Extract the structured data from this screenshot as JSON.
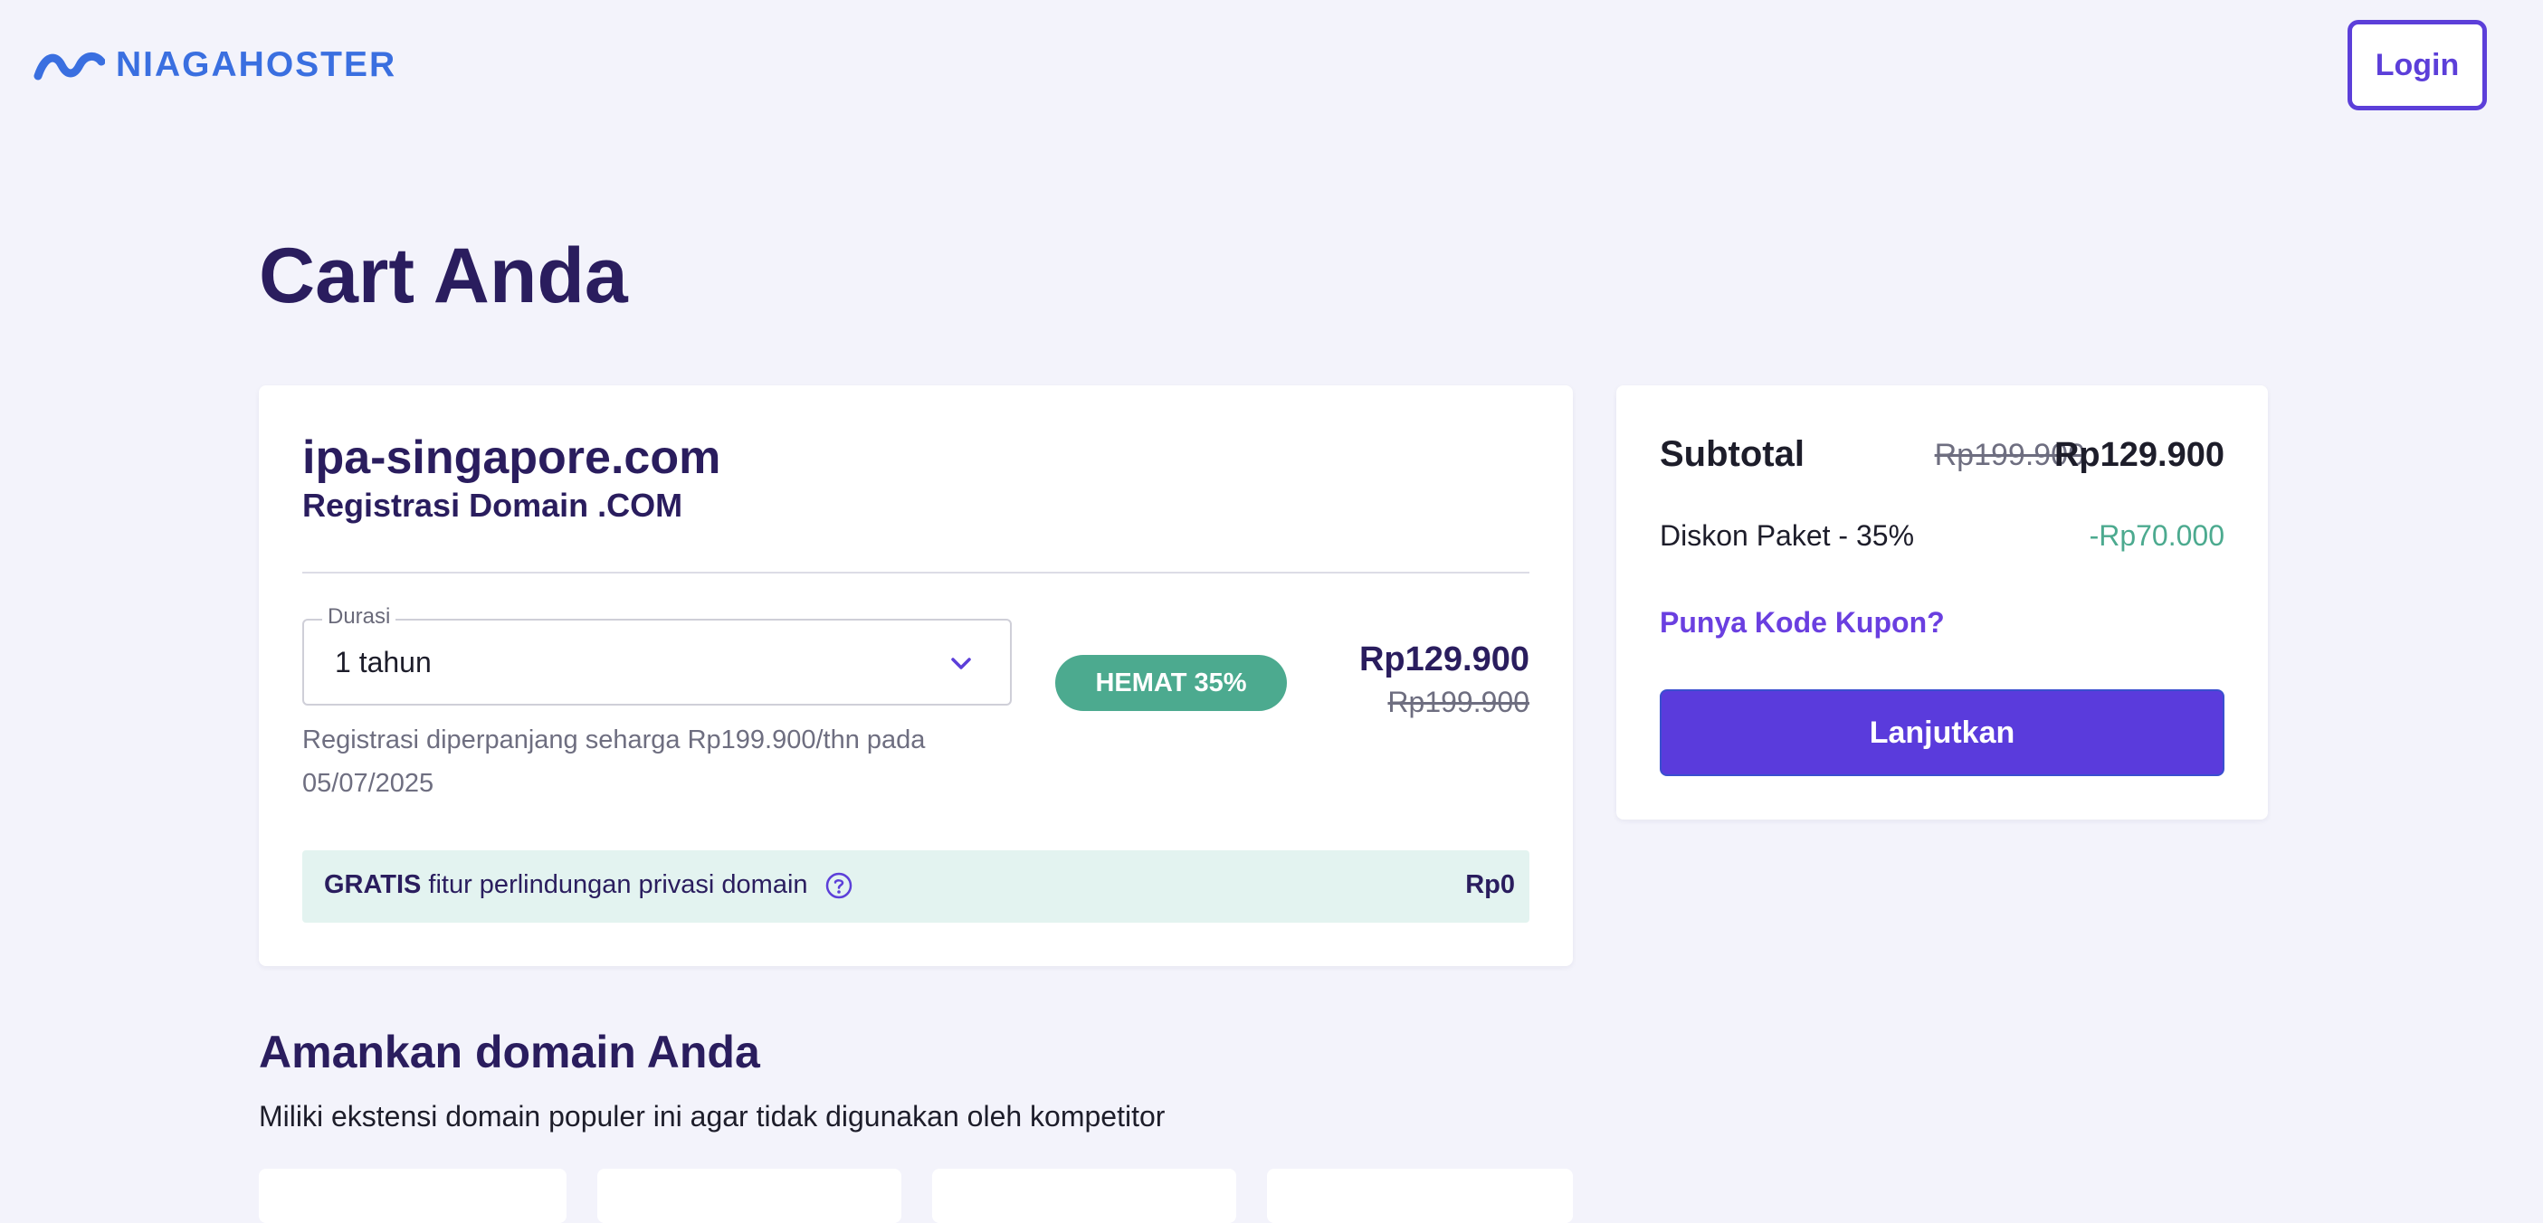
{
  "header": {
    "logo_text": "NIAGAHOSTER",
    "login_label": "Login"
  },
  "page_title": "Cart Anda",
  "cart_item": {
    "domain": "ipa-singapore.com",
    "product": "Registrasi Domain .COM",
    "duration_label": "Durasi",
    "duration_value": "1 tahun",
    "renewal_note": "Registrasi diperpanjang seharga Rp199.900/thn pada 05/07/2025",
    "badge": "HEMAT 35%",
    "price": "Rp129.900",
    "price_original": "Rp199.900",
    "privacy_bold": "GRATIS",
    "privacy_text": "fitur perlindungan privasi domain",
    "privacy_price": "Rp0"
  },
  "summary": {
    "subtotal_label": "Subtotal",
    "subtotal_original": "Rp199.900",
    "subtotal": "Rp129.900",
    "discount_label": "Diskon Paket - 35%",
    "discount_value": "-Rp70.000",
    "coupon_link": "Punya Kode Kupon?",
    "continue_label": "Lanjutkan"
  },
  "secure_section": {
    "title": "Amankan domain Anda",
    "subtitle": "Miliki ekstensi domain populer ini agar tidak digunakan oleh kompetitor"
  },
  "colors": {
    "primary": "#5a3bdc",
    "logo": "#3a6fe0",
    "heading": "#2a1d5e",
    "success": "#4caa8f",
    "background": "#f3f3fb"
  }
}
